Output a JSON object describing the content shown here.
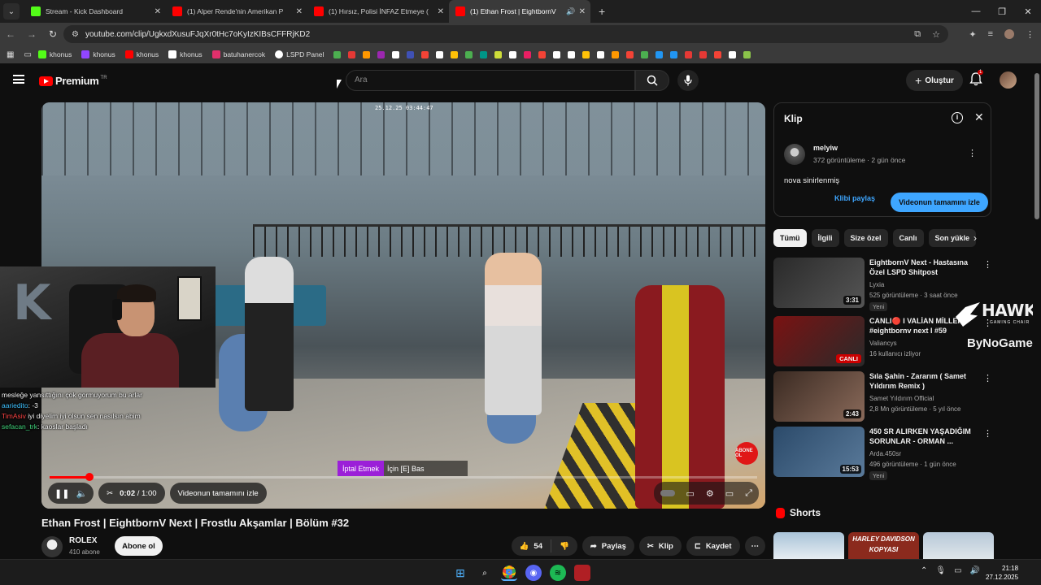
{
  "browser": {
    "tabs": [
      {
        "title": "Stream - Kick Dashboard",
        "color": "#53fc18"
      },
      {
        "title": "(1) Alper Rende'nin Amerikan P",
        "color": "#ff0000"
      },
      {
        "title": "(1) Hırsız, Polisi İNFAZ Etmeye (",
        "color": "#ff0000"
      },
      {
        "title": "(1) Ethan Frost | EightbornV",
        "color": "#ff0000"
      }
    ],
    "url": "youtube.com/clip/UgkxdXusuFJqXr0tHc7oKyIzKIBsCFFRjKD2",
    "bookmarks": [
      {
        "label": "khonus",
        "color": "#53fc18"
      },
      {
        "label": "khonus",
        "color": "#9146ff"
      },
      {
        "label": "khonus",
        "color": "#ff0000"
      },
      {
        "label": "khonus",
        "color": "#ffffff"
      },
      {
        "label": "batuhanercok",
        "color": "#e1306c"
      },
      {
        "label": "LSPD Panel",
        "color": "#ffffff"
      }
    ],
    "bookmark_icon_colors": [
      "#4caf50",
      "#e53935",
      "#ff9800",
      "#9c27b0",
      "#fff",
      "#3f51b5",
      "#f44336",
      "#fff",
      "#ffc107",
      "#4caf50",
      "#009688",
      "#cddc39",
      "#fff",
      "#e91e63",
      "#f44336",
      "#fff",
      "#fff",
      "#ffc107",
      "#fff",
      "#ff9800",
      "#f44336",
      "#4caf50",
      "#2196f3",
      "#2196f3",
      "#e53935",
      "#e53935",
      "#f44336",
      "#fff",
      "#8bc34a"
    ]
  },
  "header": {
    "brand": "Premium",
    "brand_sup": "TR",
    "search_placeholder": "Ara",
    "create_label": "Oluştur",
    "notif_count": "1"
  },
  "player": {
    "timestamp": "25.12.25 03:44:47",
    "prompt_key": "İptal Etmek",
    "prompt_rest": "İçin [E] Bas",
    "abone_label": "ABONE OL",
    "time_current": "0:02",
    "time_total": "1:00",
    "full_video_label": "Videonun tamamını izle",
    "progress": 0.056,
    "chat": [
      {
        "user": "",
        "msg": "mesleğe yansıttığını çok gormuyorum bu arlar",
        "cls": ""
      },
      {
        "user": "aariedito",
        "msg": ": -3",
        "cls": "u1"
      },
      {
        "user": "TimAsiv",
        "msg": " iyi diyelim iyi olsun sen nasılsın abim",
        "cls": "u2"
      },
      {
        "user": "sefacan_trk",
        "msg": ": kaoslar başladı",
        "cls": "u3"
      }
    ]
  },
  "video": {
    "title": "Ethan Frost | EightbornV Next | Frostlu Akşamlar | Bölüm #32",
    "channel": "ROLEX",
    "subs": "410 abone",
    "subscribe_label": "Abone ol",
    "likes": "54",
    "share_label": "Paylaş",
    "clip_label": "Klip",
    "save_label": "Kaydet"
  },
  "clip": {
    "heading": "Klip",
    "user": "melyiw",
    "meta": "372 görüntüleme · 2 gün önce",
    "desc": "nova sinirlenmiş",
    "share_label": "Klibi paylaş",
    "full_label": "Videonun tamamını izle"
  },
  "chips": [
    "Tümü",
    "İlgili",
    "Size özel",
    "Canlı",
    "Son yükle"
  ],
  "recs": [
    {
      "title": "EightbornV Next - Hastasına Özel LSPD Shitpost",
      "channel": "Lyxia",
      "meta": "525 görüntüleme · 3 saat önce",
      "badge": "Yeni",
      "duration": "3:31",
      "live": false,
      "colors": [
        "#2a2a2a",
        "#555"
      ]
    },
    {
      "title": "CANLI🔴 I VALİAN MİLLER I #eightbornv next  I #59",
      "channel": "Valiancys",
      "meta": "16 kullanıcı izliyor",
      "badge": "",
      "duration": "CANLI",
      "live": true,
      "colors": [
        "#7a1212",
        "#2a2a2a"
      ]
    },
    {
      "title": "Sıla Şahin - Zararım ( Samet Yıldırım Remix )",
      "channel": "Samet Yıldırım Official",
      "meta": "2,8 Mn görüntüleme · 5 yıl önce",
      "badge": "",
      "duration": "2:43",
      "live": false,
      "colors": [
        "#3a2a22",
        "#8a6a5a"
      ]
    },
    {
      "title": "450 SR ALIRKEN YAŞADIĞIM SORUNLAR - ORMAN ...",
      "channel": "Arda.450sr",
      "meta": "496 görüntüleme · 1 gün önce",
      "badge": "Yeni",
      "duration": "15:53",
      "live": false,
      "colors": [
        "#2b4a6a",
        "#5a7a9a"
      ]
    }
  ],
  "sponsor": {
    "brand": "HAWK",
    "sub": "GAMING CHAIR",
    "partner": "ByNoGame"
  },
  "shorts_label": "Shorts",
  "shorts_thumb_text": "HARLEY DAVIDSON KOPYASI",
  "taskbar": {
    "time": "21:18",
    "date": "27.12.2025"
  }
}
